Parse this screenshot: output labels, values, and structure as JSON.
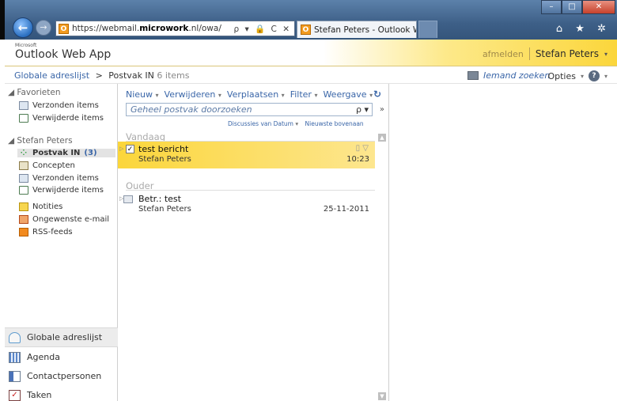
{
  "browser": {
    "url_prefix": "https://webmail.",
    "url_host": "microwork",
    "url_suffix": ".nl/owa/",
    "addr_tools": "ρ ▾ 🔒 C ✕",
    "tab_title": "Stefan Peters - Outlook We...",
    "tab_close": "✕",
    "favicon": "O",
    "icons": "⌂ ★ ✲"
  },
  "header": {
    "ms_label": "Microsoft",
    "app_name": "Outlook Web App",
    "signout": "afmelden",
    "user": "Stefan Peters",
    "user_caret": "▾"
  },
  "subbar": {
    "breadcrumb_root": "Globale adreslijst",
    "breadcrumb_sep": ">",
    "breadcrumb_current": "Postvak IN",
    "item_count": "6 items",
    "find_someone": "Iemand zoeken",
    "options": "Opties",
    "caret": "▾",
    "help": "?"
  },
  "leftnav": {
    "favorites_title": "◢ Favorieten",
    "favorites": [
      {
        "label": "Verzonden items"
      },
      {
        "label": "Verwijderde items"
      }
    ],
    "mailbox_title": "◢ Stefan Peters",
    "folders": [
      {
        "label": "Postvak IN",
        "unread": "(3)"
      },
      {
        "label": "Concepten"
      },
      {
        "label": "Verzonden items"
      },
      {
        "label": "Verwijderde items"
      },
      {
        "label": "Notities"
      },
      {
        "label": "Ongewenste e-mail"
      },
      {
        "label": "RSS-feeds"
      }
    ],
    "grip": ".....",
    "bottom": [
      {
        "label": "Globale adreslijst"
      },
      {
        "label": "Agenda"
      },
      {
        "label": "Contactpersonen"
      },
      {
        "label": "Taken"
      }
    ]
  },
  "toolbar": {
    "new": "Nieuw",
    "delete": "Verwijderen",
    "move": "Verplaatsen",
    "filter": "Filter",
    "view": "Weergave",
    "caret": "▾"
  },
  "search": {
    "placeholder": "Geheel postvak doorzoeken",
    "icon": "ρ ▾",
    "expand": "»"
  },
  "sort": {
    "conversations": "Discussies van Datum",
    "order": "Nieuwste bovenaan",
    "caret": "▾"
  },
  "groups": {
    "today": "Vandaag",
    "older": "Ouder"
  },
  "messages": [
    {
      "subject": "test bericht",
      "sender": "Stefan Peters",
      "time": "10:23",
      "flags": "▯ ▽",
      "check": "✓"
    },
    {
      "subject": "Betr.: test",
      "sender": "Stefan Peters",
      "time": "25-11-2011"
    }
  ],
  "scroll": {
    "up": "▲",
    "down": "▼"
  }
}
